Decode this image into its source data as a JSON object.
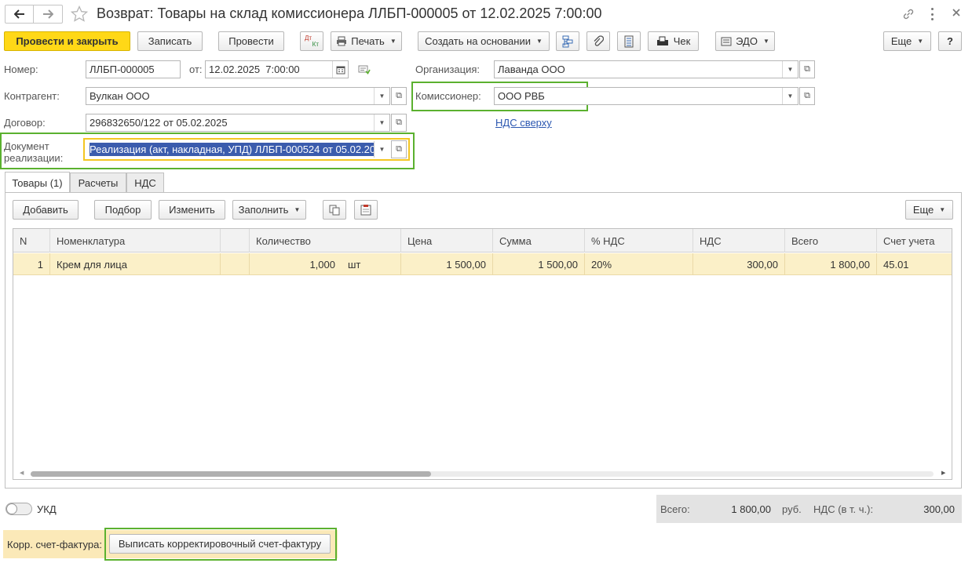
{
  "window": {
    "title": "Возврат: Товары на склад комиссионера ЛЛБП-000005 от 12.02.2025 7:00:00"
  },
  "toolbar": {
    "post_close": "Провести и закрыть",
    "save": "Записать",
    "post": "Провести",
    "dtkt_top": "Дт",
    "dtkt_bottom": "Кт",
    "print": "Печать",
    "create_based": "Создать на основании",
    "check": "Чек",
    "edo": "ЭДО",
    "more": "Еще",
    "help": "?"
  },
  "form": {
    "number_label": "Номер:",
    "number_value": "ЛЛБП-000005",
    "date_label": "от:",
    "date_value": "12.02.2025  7:00:00",
    "org_label": "Организация:",
    "org_value": "Лаванда ООО",
    "contractor_label": "Контрагент:",
    "contractor_value": "Вулкан ООО",
    "commissioner_label": "Комиссионер:",
    "commissioner_value": "ООО РВБ",
    "contract_label": "Договор:",
    "contract_value": "296832650/122 от 05.02.2025",
    "vat_link": "НДС сверху",
    "sale_doc_label_1": "Документ",
    "sale_doc_label_2": "реализации:",
    "sale_doc_value": "Реализация (акт, накладная, УПД) ЛЛБП-000524 от 05.02.20"
  },
  "tabs": [
    {
      "label": "Товары (1)",
      "active": true
    },
    {
      "label": "Расчеты",
      "active": false
    },
    {
      "label": "НДС",
      "active": false
    }
  ],
  "table_toolbar": {
    "add": "Добавить",
    "pick": "Подбор",
    "change": "Изменить",
    "fill": "Заполнить",
    "more": "Еще"
  },
  "table": {
    "columns": [
      "N",
      "Номенклатура",
      "",
      "Количество",
      "Цена",
      "Сумма",
      "% НДС",
      "НДС",
      "Всего",
      "Счет учета"
    ],
    "rows": [
      {
        "n": "1",
        "item": "Крем для лица",
        "qty": "1,000",
        "unit": "шт",
        "price": "1 500,00",
        "sum": "1 500,00",
        "vat_rate": "20%",
        "vat": "300,00",
        "total": "1 800,00",
        "account": "45.01"
      }
    ]
  },
  "footer": {
    "ukd_label": "УКД",
    "total_label": "Всего:",
    "total_value": "1 800,00",
    "currency": "руб.",
    "vat_label": "НДС (в т. ч.):",
    "vat_value": "300,00",
    "corr_label": "Корр. счет-фактура:",
    "corr_button": "Выписать корректировочный счет-фактуру"
  },
  "colors": {
    "accent_yellow": "#ffd817",
    "highlight_green": "#5bb12f",
    "focus_yellow": "#f3c623",
    "selection_blue": "#3b5cad",
    "row_selected": "#fbf0c8",
    "link_blue": "#2a56b0"
  }
}
